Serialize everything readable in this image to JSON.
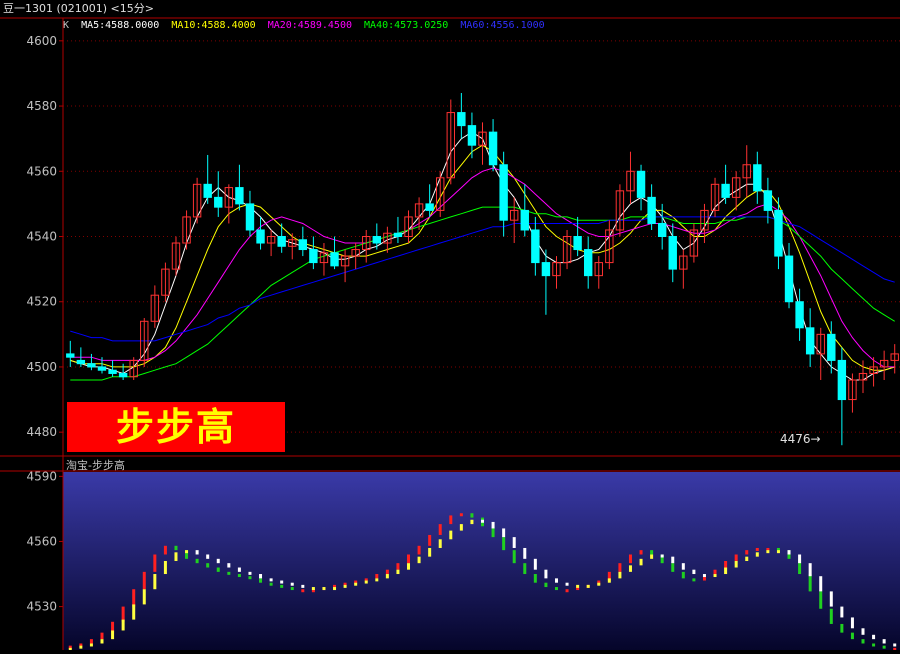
{
  "window_title": "豆一1301 (021001) <15分>",
  "main_panel": {
    "k_label": "K",
    "ma_items": [
      {
        "label": "MA5:4588.0000",
        "color": "#ffffff"
      },
      {
        "label": "MA10:4588.4000",
        "color": "#ffff00"
      },
      {
        "label": "MA20:4589.4500",
        "color": "#ff00ff"
      },
      {
        "label": "MA40:4573.0250",
        "color": "#00ff00"
      },
      {
        "label": "MA60:4556.1000",
        "color": "#0000ff"
      }
    ],
    "y_ticks": [
      "4600",
      "4580",
      "4560",
      "4540",
      "4520",
      "4500",
      "4480"
    ],
    "logo_text": "步步高",
    "low_marker": "4476"
  },
  "sub_panel": {
    "title": "淘宝-步步高",
    "y_ticks": [
      "4590",
      "4560",
      "4530"
    ]
  },
  "chart_data": {
    "type": "line",
    "main_ylim": [
      4473,
      4607
    ],
    "sub_ylim": [
      4510,
      4592
    ],
    "candles": [
      [
        4504,
        4508,
        4500,
        4503
      ],
      [
        4502,
        4506,
        4500,
        4501
      ],
      [
        4501,
        4504,
        4499,
        4500
      ],
      [
        4500,
        4503,
        4498,
        4499
      ],
      [
        4499,
        4502,
        4497,
        4498
      ],
      [
        4498,
        4501,
        4496,
        4497
      ],
      [
        4497,
        4503,
        4496,
        4502
      ],
      [
        4502,
        4515,
        4500,
        4514
      ],
      [
        4514,
        4525,
        4512,
        4522
      ],
      [
        4522,
        4532,
        4520,
        4530
      ],
      [
        4530,
        4540,
        4528,
        4538
      ],
      [
        4538,
        4548,
        4536,
        4546
      ],
      [
        4546,
        4558,
        4544,
        4556
      ],
      [
        4556,
        4565,
        4550,
        4552
      ],
      [
        4552,
        4560,
        4546,
        4549
      ],
      [
        4549,
        4556,
        4544,
        4555
      ],
      [
        4555,
        4562,
        4548,
        4550
      ],
      [
        4550,
        4554,
        4540,
        4542
      ],
      [
        4542,
        4546,
        4536,
        4538
      ],
      [
        4538,
        4542,
        4534,
        4540
      ],
      [
        4540,
        4544,
        4535,
        4537
      ],
      [
        4537,
        4541,
        4533,
        4539
      ],
      [
        4539,
        4543,
        4534,
        4536
      ],
      [
        4536,
        4540,
        4530,
        4532
      ],
      [
        4532,
        4538,
        4528,
        4535
      ],
      [
        4535,
        4540,
        4530,
        4531
      ],
      [
        4531,
        4536,
        4526,
        4534
      ],
      [
        4534,
        4538,
        4530,
        4536
      ],
      [
        4536,
        4542,
        4532,
        4540
      ],
      [
        4540,
        4544,
        4536,
        4538
      ],
      [
        4538,
        4543,
        4535,
        4541
      ],
      [
        4541,
        4546,
        4538,
        4540
      ],
      [
        4540,
        4548,
        4538,
        4546
      ],
      [
        4546,
        4552,
        4542,
        4550
      ],
      [
        4550,
        4556,
        4546,
        4548
      ],
      [
        4548,
        4560,
        4546,
        4558
      ],
      [
        4558,
        4582,
        4556,
        4578
      ],
      [
        4578,
        4584,
        4570,
        4574
      ],
      [
        4574,
        4578,
        4564,
        4568
      ],
      [
        4568,
        4575,
        4562,
        4572
      ],
      [
        4572,
        4576,
        4560,
        4562
      ],
      [
        4562,
        4566,
        4540,
        4545
      ],
      [
        4545,
        4552,
        4538,
        4548
      ],
      [
        4548,
        4556,
        4540,
        4542
      ],
      [
        4542,
        4546,
        4528,
        4532
      ],
      [
        4532,
        4536,
        4516,
        4528
      ],
      [
        4528,
        4534,
        4524,
        4532
      ],
      [
        4532,
        4542,
        4530,
        4540
      ],
      [
        4540,
        4546,
        4534,
        4536
      ],
      [
        4536,
        4540,
        4524,
        4528
      ],
      [
        4528,
        4534,
        4524,
        4532
      ],
      [
        4532,
        4545,
        4530,
        4542
      ],
      [
        4542,
        4556,
        4540,
        4554
      ],
      [
        4554,
        4566,
        4550,
        4560
      ],
      [
        4560,
        4562,
        4548,
        4552
      ],
      [
        4552,
        4556,
        4542,
        4544
      ],
      [
        4544,
        4550,
        4536,
        4540
      ],
      [
        4540,
        4544,
        4526,
        4530
      ],
      [
        4530,
        4536,
        4524,
        4534
      ],
      [
        4534,
        4544,
        4532,
        4542
      ],
      [
        4542,
        4550,
        4538,
        4548
      ],
      [
        4548,
        4558,
        4546,
        4556
      ],
      [
        4556,
        4562,
        4550,
        4552
      ],
      [
        4552,
        4560,
        4548,
        4558
      ],
      [
        4558,
        4568,
        4552,
        4562
      ],
      [
        4562,
        4566,
        4550,
        4554
      ],
      [
        4554,
        4558,
        4544,
        4548
      ],
      [
        4548,
        4552,
        4530,
        4534
      ],
      [
        4534,
        4538,
        4518,
        4520
      ],
      [
        4520,
        4524,
        4508,
        4512
      ],
      [
        4512,
        4518,
        4500,
        4504
      ],
      [
        4504,
        4512,
        4496,
        4510
      ],
      [
        4510,
        4514,
        4498,
        4502
      ],
      [
        4502,
        4506,
        4476,
        4490
      ],
      [
        4490,
        4498,
        4486,
        4496
      ],
      [
        4496,
        4502,
        4492,
        4498
      ],
      [
        4498,
        4503,
        4494,
        4500
      ],
      [
        4500,
        4505,
        4496,
        4502
      ],
      [
        4502,
        4507,
        4498,
        4504
      ]
    ],
    "ma": [
      {
        "name": "MA5",
        "color": "#ffffff",
        "values": [
          4502,
          4501,
          4500,
          4500,
          4499,
          4498,
          4500,
          4504,
          4510,
          4519,
          4528,
          4538,
          4546,
          4552,
          4555,
          4552,
          4551,
          4549,
          4546,
          4542,
          4539,
          4538,
          4537,
          4536,
          4535,
          4533,
          4533,
          4534,
          4536,
          4537,
          4539,
          4540,
          4542,
          4546,
          4550,
          4558,
          4566,
          4570,
          4572,
          4570,
          4562,
          4556,
          4552,
          4546,
          4539,
          4534,
          4532,
          4532,
          4533,
          4535,
          4536,
          4540,
          4546,
          4550,
          4552,
          4550,
          4546,
          4540,
          4536,
          4538,
          4543,
          4549,
          4552,
          4554,
          4556,
          4556,
          4552,
          4542,
          4530,
          4518,
          4508,
          4504,
          4500,
          4498,
          4496,
          4496,
          4498,
          4499,
          4500
        ]
      },
      {
        "name": "MA10",
        "color": "#ffff00",
        "values": [
          4502,
          4501,
          4501,
          4501,
          4500,
          4500,
          4500,
          4501,
          4503,
          4506,
          4512,
          4520,
          4528,
          4536,
          4543,
          4547,
          4549,
          4550,
          4549,
          4546,
          4543,
          4540,
          4538,
          4537,
          4536,
          4535,
          4534,
          4534,
          4534,
          4535,
          4536,
          4537,
          4538,
          4541,
          4546,
          4552,
          4558,
          4562,
          4566,
          4568,
          4566,
          4562,
          4558,
          4553,
          4548,
          4543,
          4540,
          4538,
          4536,
          4535,
          4535,
          4536,
          4538,
          4541,
          4545,
          4548,
          4548,
          4546,
          4543,
          4540,
          4540,
          4542,
          4546,
          4549,
          4552,
          4554,
          4554,
          4550,
          4543,
          4535,
          4526,
          4517,
          4510,
          4506,
          4502,
          4500,
          4499,
          4499,
          4500
        ]
      },
      {
        "name": "MA20",
        "color": "#ff00ff",
        "values": [
          4503,
          4503,
          4503,
          4502,
          4502,
          4502,
          4502,
          4502,
          4503,
          4505,
          4508,
          4512,
          4516,
          4521,
          4526,
          4531,
          4536,
          4540,
          4543,
          4545,
          4546,
          4545,
          4544,
          4542,
          4540,
          4539,
          4538,
          4538,
          4538,
          4539,
          4540,
          4541,
          4542,
          4544,
          4546,
          4549,
          4552,
          4555,
          4558,
          4560,
          4561,
          4560,
          4558,
          4556,
          4553,
          4550,
          4547,
          4545,
          4543,
          4541,
          4540,
          4540,
          4541,
          4542,
          4543,
          4544,
          4544,
          4543,
          4542,
          4541,
          4541,
          4542,
          4544,
          4546,
          4547,
          4549,
          4550,
          4548,
          4545,
          4540,
          4534,
          4528,
          4521,
          4514,
          4509,
          4505,
          4502,
          4500,
          4500
        ]
      },
      {
        "name": "MA40",
        "color": "#00ff00",
        "values": [
          4496,
          4496,
          4496,
          4496,
          4497,
          4497,
          4497,
          4498,
          4499,
          4500,
          4501,
          4503,
          4505,
          4507,
          4510,
          4513,
          4516,
          4519,
          4522,
          4525,
          4527,
          4529,
          4531,
          4533,
          4534,
          4535,
          4536,
          4537,
          4538,
          4539,
          4540,
          4541,
          4542,
          4543,
          4544,
          4545,
          4546,
          4547,
          4548,
          4549,
          4549,
          4549,
          4549,
          4548,
          4547,
          4547,
          4546,
          4546,
          4545,
          4545,
          4545,
          4545,
          4545,
          4546,
          4546,
          4546,
          4546,
          4545,
          4544,
          4544,
          4544,
          4544,
          4545,
          4545,
          4546,
          4546,
          4546,
          4545,
          4543,
          4540,
          4537,
          4534,
          4530,
          4527,
          4524,
          4521,
          4518,
          4516,
          4514
        ]
      },
      {
        "name": "MA60",
        "color": "#0000ff",
        "values": [
          4511,
          4510,
          4509,
          4509,
          4508,
          4508,
          4508,
          4508,
          4508,
          4509,
          4510,
          4511,
          4512,
          4513,
          4515,
          4516,
          4518,
          4519,
          4521,
          4522,
          4523,
          4524,
          4525,
          4526,
          4527,
          4528,
          4529,
          4530,
          4531,
          4532,
          4533,
          4534,
          4535,
          4536,
          4537,
          4538,
          4539,
          4540,
          4541,
          4542,
          4543,
          4543,
          4544,
          4544,
          4544,
          4544,
          4544,
          4544,
          4544,
          4544,
          4544,
          4545,
          4545,
          4545,
          4545,
          4546,
          4546,
          4546,
          4546,
          4546,
          4546,
          4546,
          4546,
          4546,
          4546,
          4546,
          4546,
          4545,
          4544,
          4543,
          4541,
          4539,
          4537,
          4535,
          4533,
          4531,
          4529,
          4527,
          4526
        ]
      }
    ],
    "sub_series": [
      {
        "name": "fast",
        "values": [
          4512,
          4513,
          4515,
          4518,
          4523,
          4530,
          4538,
          4546,
          4554,
          4558,
          4556,
          4552,
          4550,
          4548,
          4546,
          4545,
          4544,
          4543,
          4541,
          4540,
          4539,
          4538,
          4538,
          4538,
          4539,
          4540,
          4541,
          4542,
          4543,
          4545,
          4547,
          4550,
          4554,
          4558,
          4563,
          4568,
          4572,
          4573,
          4571,
          4567,
          4562,
          4556,
          4550,
          4545,
          4541,
          4539,
          4538,
          4538,
          4539,
          4540,
          4542,
          4546,
          4550,
          4554,
          4556,
          4554,
          4550,
          4546,
          4543,
          4542,
          4544,
          4547,
          4551,
          4554,
          4556,
          4557,
          4557,
          4556,
          4552,
          4545,
          4537,
          4529,
          4522,
          4518,
          4515,
          4513,
          4512,
          4511,
          4511
        ]
      },
      {
        "name": "slow",
        "values": [
          4511,
          4512,
          4513,
          4515,
          4519,
          4524,
          4531,
          4538,
          4545,
          4551,
          4555,
          4556,
          4554,
          4552,
          4550,
          4548,
          4546,
          4545,
          4543,
          4542,
          4541,
          4540,
          4539,
          4539,
          4539,
          4539,
          4540,
          4541,
          4542,
          4543,
          4545,
          4547,
          4550,
          4553,
          4557,
          4561,
          4565,
          4568,
          4570,
          4569,
          4566,
          4562,
          4557,
          4552,
          4547,
          4543,
          4541,
          4540,
          4540,
          4540,
          4541,
          4543,
          4546,
          4549,
          4552,
          4554,
          4553,
          4550,
          4547,
          4545,
          4544,
          4545,
          4548,
          4551,
          4553,
          4555,
          4556,
          4556,
          4554,
          4550,
          4544,
          4537,
          4530,
          4525,
          4520,
          4517,
          4515,
          4513,
          4512
        ]
      }
    ]
  }
}
